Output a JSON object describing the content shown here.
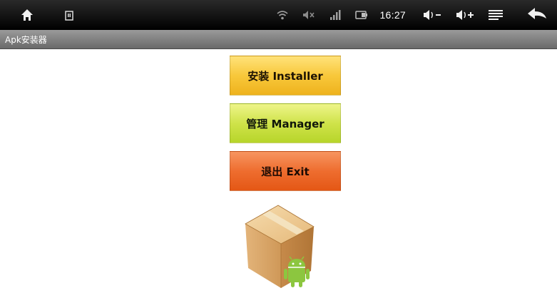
{
  "status_bar": {
    "time": "16:27",
    "icons": [
      "home-icon",
      "notification-icon",
      "wifi-icon",
      "mute-icon",
      "signal-icon",
      "battery-icon",
      "volume-down-icon",
      "volume-up-icon",
      "menu-icon",
      "back-icon"
    ]
  },
  "title_bar": {
    "title": "Apk安装器"
  },
  "actions": {
    "install_label": "安装 Installer",
    "manager_label": "管理 Manager",
    "exit_label": "退出 Exit"
  },
  "logo": {
    "icon": "package-box-with-android-logo"
  },
  "colors": {
    "install": "#f8c83b",
    "manager": "#cfe34a",
    "exit": "#ee6d2f",
    "android_green": "#8cc63f"
  }
}
